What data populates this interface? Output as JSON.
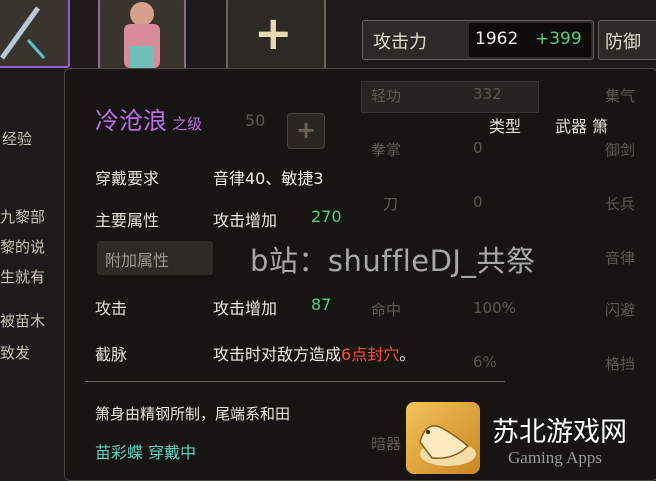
{
  "stats_panel": {
    "attack_label": "攻击力",
    "attack_value": "1962",
    "attack_bonus": "+399",
    "defense_label": "防御"
  },
  "tooltip": {
    "item_name": "冷沧浪",
    "item_rank": "之级",
    "type_label": "类型",
    "type_value": "武器 箫",
    "requirement": {
      "label": "穿戴要求",
      "value": "音律40、敏捷3"
    },
    "main_attr": {
      "label": "主要属性",
      "value": "攻击增加",
      "bonus": "270"
    },
    "extra_attr_tab": "附加属性",
    "attack_attr": {
      "label": "攻击",
      "value": "攻击增加",
      "bonus": "87"
    },
    "special_attr": {
      "label": "截脉",
      "value_prefix": "攻击时对敌方造成",
      "value_highlight": "6点封穴",
      "value_suffix": "。"
    },
    "description": "箫身由精钢所制，尾端系和田",
    "wearer": "苗彩蝶 穿戴中"
  },
  "watermark": "b站：shuffleDJ_共祭",
  "logo": {
    "title": "苏北游戏网",
    "subtitle": "Gaming Apps"
  },
  "background": {
    "level_stub": "50",
    "exp_label": "经验",
    "story_fragments": [
      "九黎部",
      "黎的说",
      "生就有",
      "被苗木",
      "致发"
    ],
    "stat_names": [
      "轻功",
      "拳掌",
      "刀",
      "命中",
      "",
      "暗器"
    ],
    "stat_values": [
      "332",
      "0",
      "0",
      "100%",
      "6%"
    ],
    "right_stats": [
      "集气",
      "御剑",
      "长兵",
      "音律",
      "闪避",
      "格挡"
    ],
    "colors": {
      "attack_bonus": "#4fd27a",
      "highlight": "#ff4a3a",
      "purple_name": "#c06cf0"
    }
  }
}
